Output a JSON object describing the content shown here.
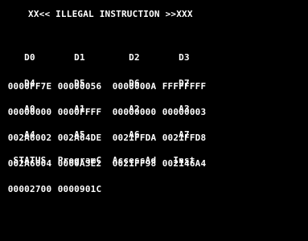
{
  "header": "XX<< ILLEGAL INSTRUCTION >>XXX",
  "registers": [
    {
      "name": "D0",
      "value": "0000FF7E"
    },
    {
      "name": "D1",
      "value": "00000056"
    },
    {
      "name": "D2",
      "value": "0000000A"
    },
    {
      "name": "D3",
      "value": "FFFFFFFF"
    },
    {
      "name": "D4",
      "value": "00000000"
    },
    {
      "name": "D5",
      "value": "0000FFFF"
    },
    {
      "name": "D6",
      "value": "00000000"
    },
    {
      "name": "D7",
      "value": "00000003"
    },
    {
      "name": "A0",
      "value": "002A6002"
    },
    {
      "name": "A1",
      "value": "002A64DE"
    },
    {
      "name": "A2",
      "value": "0021FFDA"
    },
    {
      "name": "A3",
      "value": "0021FFD8"
    },
    {
      "name": "A4",
      "value": "002A6004"
    },
    {
      "name": "A5",
      "value": "0000A3E2"
    },
    {
      "name": "A6",
      "value": "0021FF98"
    },
    {
      "name": "A7",
      "value": "002146A4"
    },
    {
      "name": "STATUS",
      "value": "00002700"
    },
    {
      "name": "ProgramC",
      "value": "0000901C"
    },
    {
      "name": "AccessAd",
      "value": ""
    },
    {
      "name": "Inst",
      "value": ""
    }
  ]
}
